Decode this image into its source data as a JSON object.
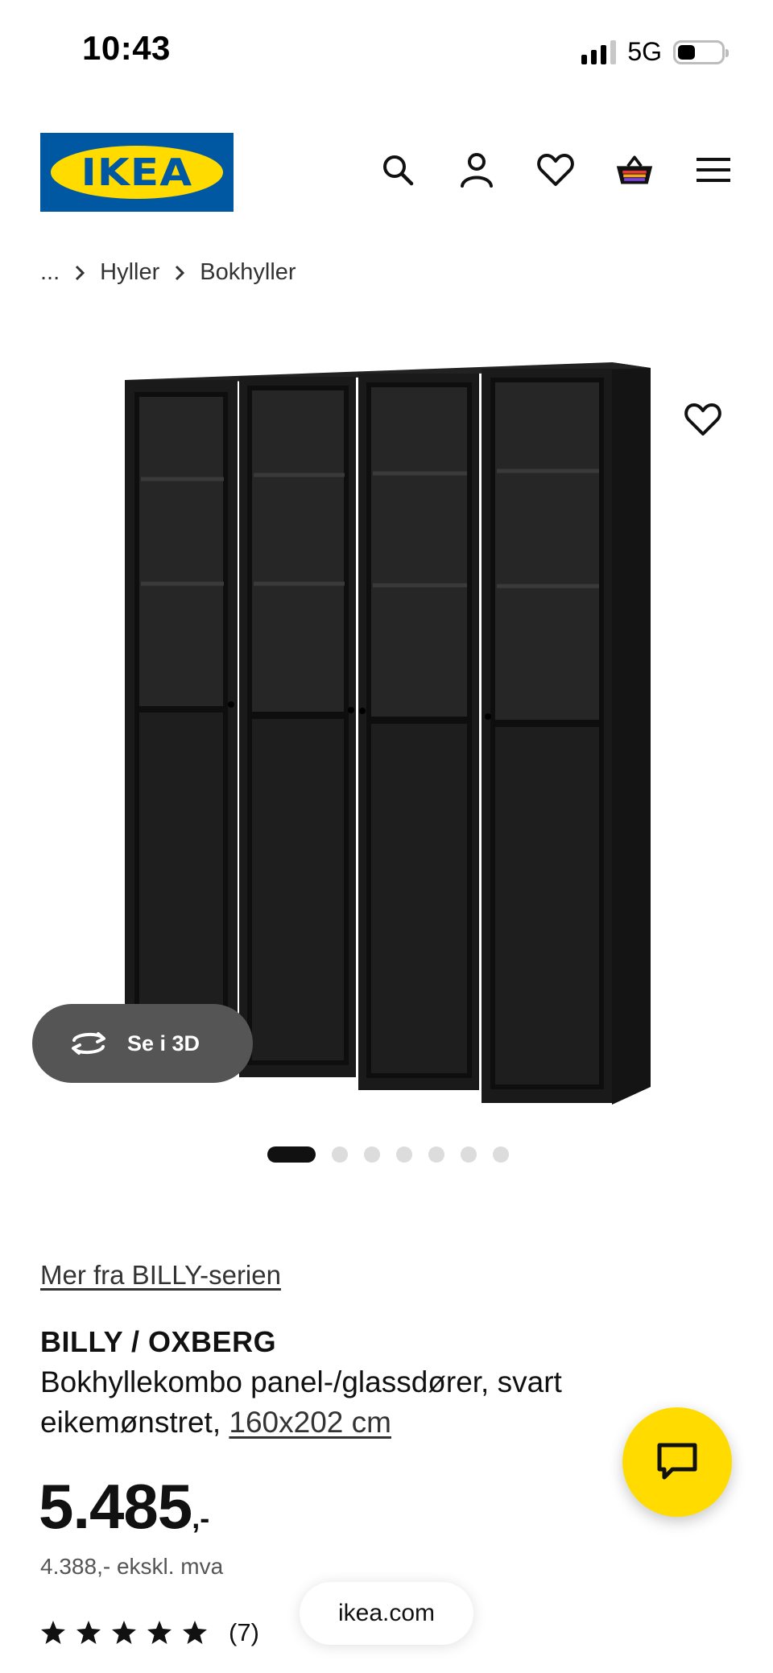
{
  "status_bar": {
    "time": "10:43",
    "network": "5G",
    "signal_bars": 3,
    "battery_level": 0.25
  },
  "header": {
    "logo_text": "IKEA",
    "icons": [
      "search-icon",
      "account-icon",
      "heart-icon",
      "basket-icon",
      "menu-icon"
    ],
    "brand_blue": "#0058a3",
    "brand_yellow": "#ffdb00"
  },
  "breadcrumb": {
    "items": [
      "...",
      "Hyller",
      "Bokhyller"
    ]
  },
  "gallery": {
    "view_3d_label": "Se i 3D",
    "image_count": 7,
    "active_index": 0
  },
  "product": {
    "series_link": "Mer fra BILLY-serien",
    "name": "BILLY / OXBERG",
    "description": "Bokhyllekombo panel-/glassdører, svart eikemønstret,",
    "size": "160x202 cm",
    "price_main": "5.485",
    "price_suffix": ",-",
    "price_ex_vat": "4.388,- ekskl. mva",
    "rating": 5,
    "review_count": "(7)"
  },
  "browser": {
    "url": "ikea.com"
  }
}
